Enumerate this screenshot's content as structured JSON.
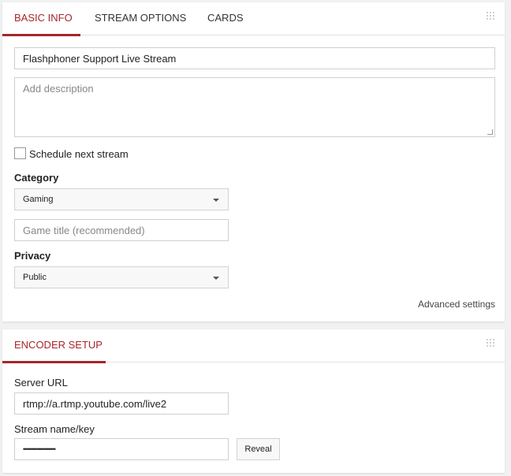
{
  "basic_panel": {
    "tabs": [
      {
        "label": "BASIC INFO",
        "active": true
      },
      {
        "label": "STREAM OPTIONS",
        "active": false
      },
      {
        "label": "CARDS",
        "active": false
      }
    ],
    "title_value": "Flashphoner Support Live Stream",
    "description_placeholder": "Add description",
    "schedule_label": "Schedule next stream",
    "schedule_checked": false,
    "category_label": "Category",
    "category_value": "Gaming",
    "game_title_placeholder": "Game title (recommended)",
    "privacy_label": "Privacy",
    "privacy_value": "Public",
    "advanced_link": "Advanced settings"
  },
  "encoder_panel": {
    "tab": "ENCODER SETUP",
    "server_url_label": "Server URL",
    "server_url_value": "rtmp://a.rtmp.youtube.com/live2",
    "stream_key_label": "Stream name/key",
    "stream_key_masked": "•••••••••••••••••••",
    "reveal_label": "Reveal"
  },
  "colors": {
    "accent": "#a6262b",
    "background": "#f1f1f1"
  }
}
